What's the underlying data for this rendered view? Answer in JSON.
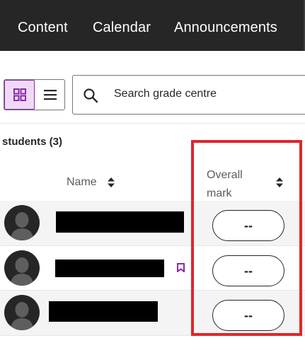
{
  "nav": {
    "tabs": [
      "Content",
      "Calendar",
      "Announcements"
    ]
  },
  "toolbar": {
    "active_view": "grid",
    "search_placeholder": "Search grade centre"
  },
  "students": {
    "title": "students (3)",
    "columns": {
      "name": "Name",
      "overall_mark": "Overall mark"
    },
    "rows": [
      {
        "name_redacted": true,
        "overall_mark": "--",
        "flagged": false
      },
      {
        "name_redacted": true,
        "overall_mark": "--",
        "flagged": true
      },
      {
        "name_redacted": true,
        "overall_mark": "--",
        "flagged": false
      }
    ]
  },
  "colors": {
    "nav_bg": "#262626",
    "accent": "#8a2aa6",
    "accent_bg": "#f0d9f6",
    "highlight": "#e0262b"
  }
}
